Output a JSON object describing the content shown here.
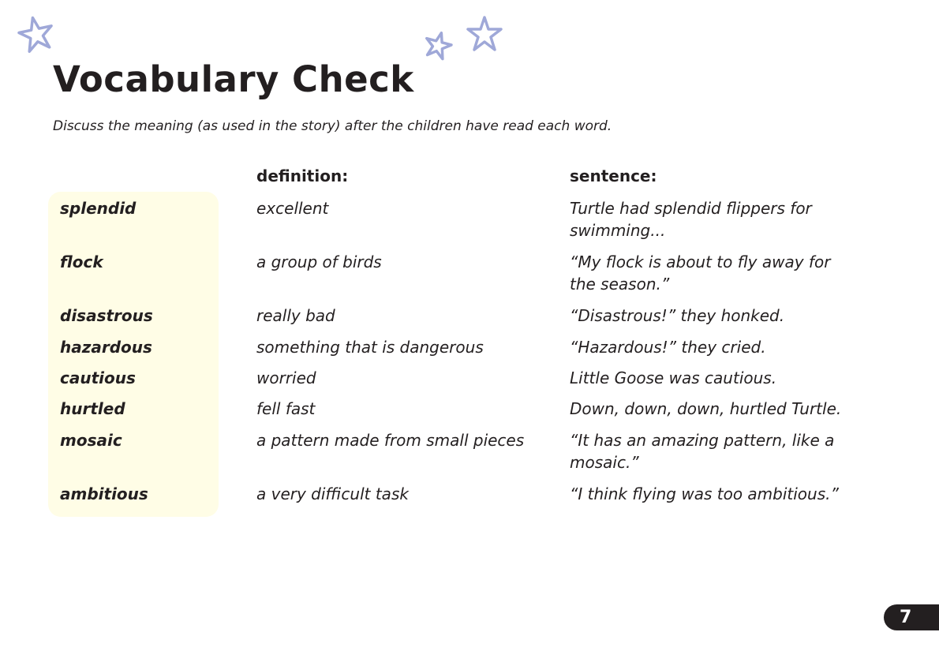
{
  "title": "Vocabulary Check",
  "intro": "Discuss the meaning (as used in the story) after the children have read each word.",
  "headers": {
    "definition": "definition:",
    "sentence": "sentence:"
  },
  "rows": [
    {
      "word": "splendid",
      "definition": "excellent",
      "sentence": "Turtle had splendid flippers for swimming..."
    },
    {
      "word": "flock",
      "definition": "a group of birds",
      "sentence": "“My flock is about to fly away for the season.”"
    },
    {
      "word": "disastrous",
      "definition": "really bad",
      "sentence": "“Disastrous!” they honked."
    },
    {
      "word": "hazardous",
      "definition": "something that is dangerous",
      "sentence": "“Hazardous!” they cried."
    },
    {
      "word": "cautious",
      "definition": "worried",
      "sentence": "Little Goose was cautious."
    },
    {
      "word": "hurtled",
      "definition": "fell fast",
      "sentence": "Down, down, down, hurtled Turtle."
    },
    {
      "word": "mosaic",
      "definition": "a pattern made from small pieces",
      "sentence": "“It has an amazing pattern, like a mosaic.”"
    },
    {
      "word": "ambitious",
      "definition": "a very difficult task",
      "sentence": "“I think flying was too ambitious.”"
    }
  ],
  "page_number": "7",
  "colors": {
    "star": "#9fa8d8",
    "highlight": "#fffde6",
    "text": "#231f20"
  }
}
